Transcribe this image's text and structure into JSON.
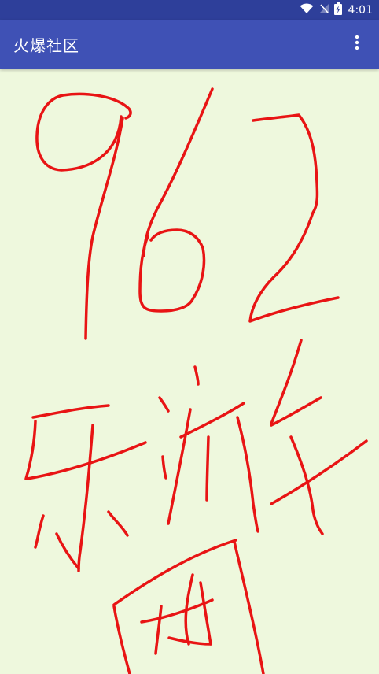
{
  "status_bar": {
    "time": "4:01",
    "icons": [
      "wifi-icon",
      "no-signal-icon",
      "battery-charging-icon"
    ],
    "background": "#2e3f9a"
  },
  "app_bar": {
    "title": "火爆社区",
    "menu_icon": "more-vert-icon",
    "background": "#3f51b5"
  },
  "canvas": {
    "background": "#eef8dd",
    "stroke_color": "#e81414"
  }
}
